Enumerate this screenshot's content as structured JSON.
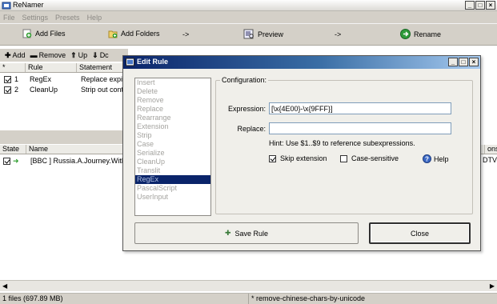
{
  "app": {
    "title": "ReNamer",
    "menu": [
      "File",
      "Settings",
      "Presets",
      "Help"
    ]
  },
  "toolbar": {
    "add_files": "Add Files",
    "add_folders": "Add Folders",
    "arrow1": "->",
    "preview": "Preview",
    "arrow2": "->",
    "rename": "Rename"
  },
  "rules_toolbar": {
    "add": "Add",
    "remove": "Remove",
    "up": "Up",
    "down": "Dc"
  },
  "rules_table": {
    "columns": [
      "*",
      "Rule",
      "Statement"
    ],
    "rows": [
      {
        "num": "1",
        "rule": "RegEx",
        "statement": "Replace expi",
        "checked": true
      },
      {
        "num": "2",
        "rule": "CleanUp",
        "statement": "Strip out conte",
        "checked": true
      }
    ]
  },
  "files_table": {
    "columns": [
      "State",
      "Name"
    ],
    "rows": [
      {
        "name": "[BBC ] Russia.A.Journey.With",
        "checked": true
      }
    ],
    "right_header": "ons",
    "right_cell": "DTV"
  },
  "statusbar": {
    "files": "1 files (697.89 MB)",
    "preset": "* remove-chinese-chars-by-unicode"
  },
  "dialog": {
    "title": "Edit Rule",
    "rule_types": [
      "Insert",
      "Delete",
      "Remove",
      "Replace",
      "Rearrange",
      "Extension",
      "Strip",
      "Case",
      "Serialize",
      "CleanUp",
      "Translit",
      "RegEx",
      "PascalScript",
      "UserInput"
    ],
    "selected_rule": "RegEx",
    "config_legend": "Configuration:",
    "expression_label": "Expression:",
    "expression_value": "[\\x{4E00}-\\x{9FFF}]",
    "replace_label": "Replace:",
    "replace_value": "",
    "hint": "Hint: Use $1..$9 to reference subexpressions.",
    "skip_extension": "Skip extension",
    "skip_extension_checked": true,
    "case_sensitive": "Case-sensitive",
    "case_sensitive_checked": false,
    "help": "Help",
    "save_rule": "Save Rule",
    "close": "Close"
  },
  "colors": {
    "dialog_title_start": "#0a246a",
    "selection": "#0a246a",
    "toolbar_bg": "#d4d0c8"
  }
}
